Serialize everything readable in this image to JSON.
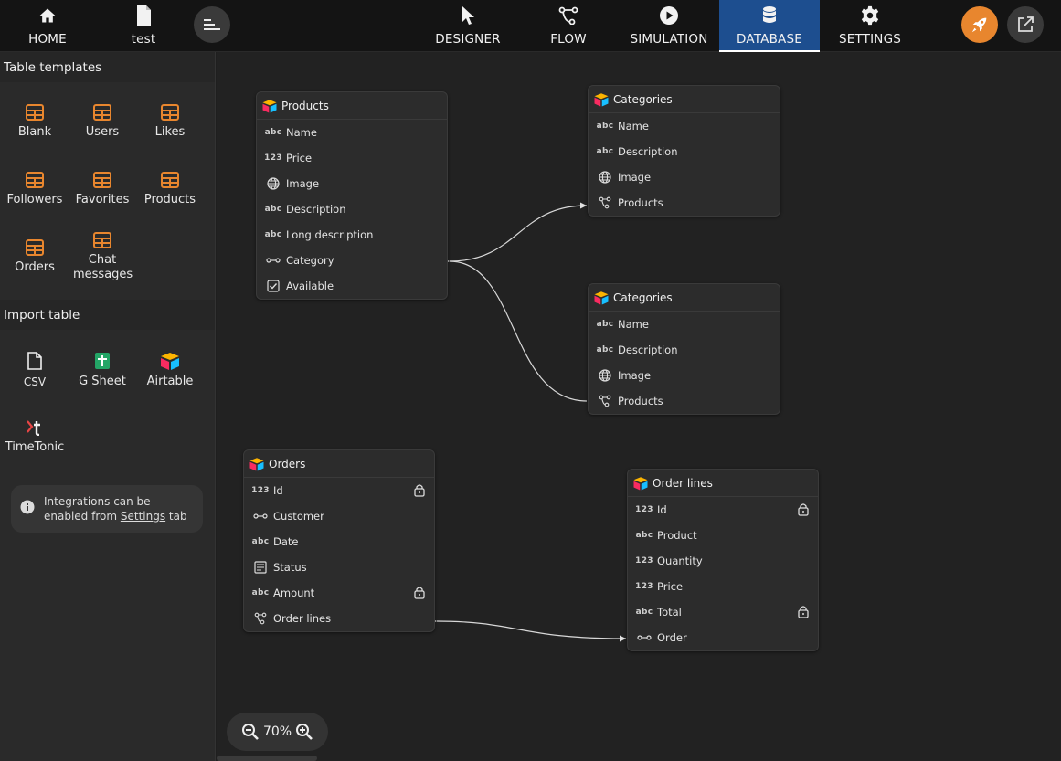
{
  "topbar": {
    "home_label": "HOME",
    "project_label": "test",
    "tabs": [
      {
        "label": "DESIGNER",
        "icon": "cursor-icon"
      },
      {
        "label": "FLOW",
        "icon": "flow-icon"
      },
      {
        "label": "SIMULATION",
        "icon": "play-icon"
      },
      {
        "label": "DATABASE",
        "icon": "database-icon",
        "active": true
      },
      {
        "label": "SETTINGS",
        "icon": "gear-icon"
      }
    ],
    "accent_color": "#e8862e",
    "active_tab_color": "#1d4e8f"
  },
  "sidebar": {
    "templates_title": "Table templates",
    "templates": [
      "Blank",
      "Users",
      "Likes",
      "Followers",
      "Favorites",
      "Products",
      "Orders",
      "Chat messages"
    ],
    "import_title": "Import table",
    "imports": [
      "CSV",
      "G Sheet",
      "Airtable",
      "TimeTonic"
    ],
    "info_prefix": "Integrations can be enabled from",
    "info_link": "Settings",
    "info_suffix": "tab"
  },
  "tables": {
    "products": {
      "name": "Products",
      "fields": [
        {
          "type": "abc",
          "name": "Name"
        },
        {
          "type": "123",
          "name": "Price"
        },
        {
          "type": "globe",
          "name": "Image"
        },
        {
          "type": "abc",
          "name": "Description"
        },
        {
          "type": "abc",
          "name": "Long description"
        },
        {
          "type": "link",
          "name": "Category"
        },
        {
          "type": "check",
          "name": "Available"
        }
      ]
    },
    "categories_a": {
      "name": "Categories",
      "fields": [
        {
          "type": "abc",
          "name": "Name"
        },
        {
          "type": "abc",
          "name": "Description"
        },
        {
          "type": "globe",
          "name": "Image"
        },
        {
          "type": "multi",
          "name": "Products"
        }
      ]
    },
    "categories_b": {
      "name": "Categories",
      "fields": [
        {
          "type": "abc",
          "name": "Name"
        },
        {
          "type": "abc",
          "name": "Description"
        },
        {
          "type": "globe",
          "name": "Image"
        },
        {
          "type": "multi",
          "name": "Products"
        }
      ]
    },
    "orders": {
      "name": "Orders",
      "fields": [
        {
          "type": "123",
          "name": "Id",
          "locked": true
        },
        {
          "type": "link",
          "name": "Customer"
        },
        {
          "type": "abc",
          "name": "Date"
        },
        {
          "type": "list",
          "name": "Status"
        },
        {
          "type": "abc",
          "name": "Amount",
          "locked": true
        },
        {
          "type": "multi",
          "name": "Order lines"
        }
      ]
    },
    "order_lines": {
      "name": "Order lines",
      "fields": [
        {
          "type": "123",
          "name": "Id",
          "locked": true
        },
        {
          "type": "abc",
          "name": "Product"
        },
        {
          "type": "123",
          "name": "Quantity"
        },
        {
          "type": "123",
          "name": "Price"
        },
        {
          "type": "abc",
          "name": "Total",
          "locked": true
        },
        {
          "type": "link",
          "name": "Order"
        }
      ]
    }
  },
  "zoom": {
    "value": "70%"
  }
}
